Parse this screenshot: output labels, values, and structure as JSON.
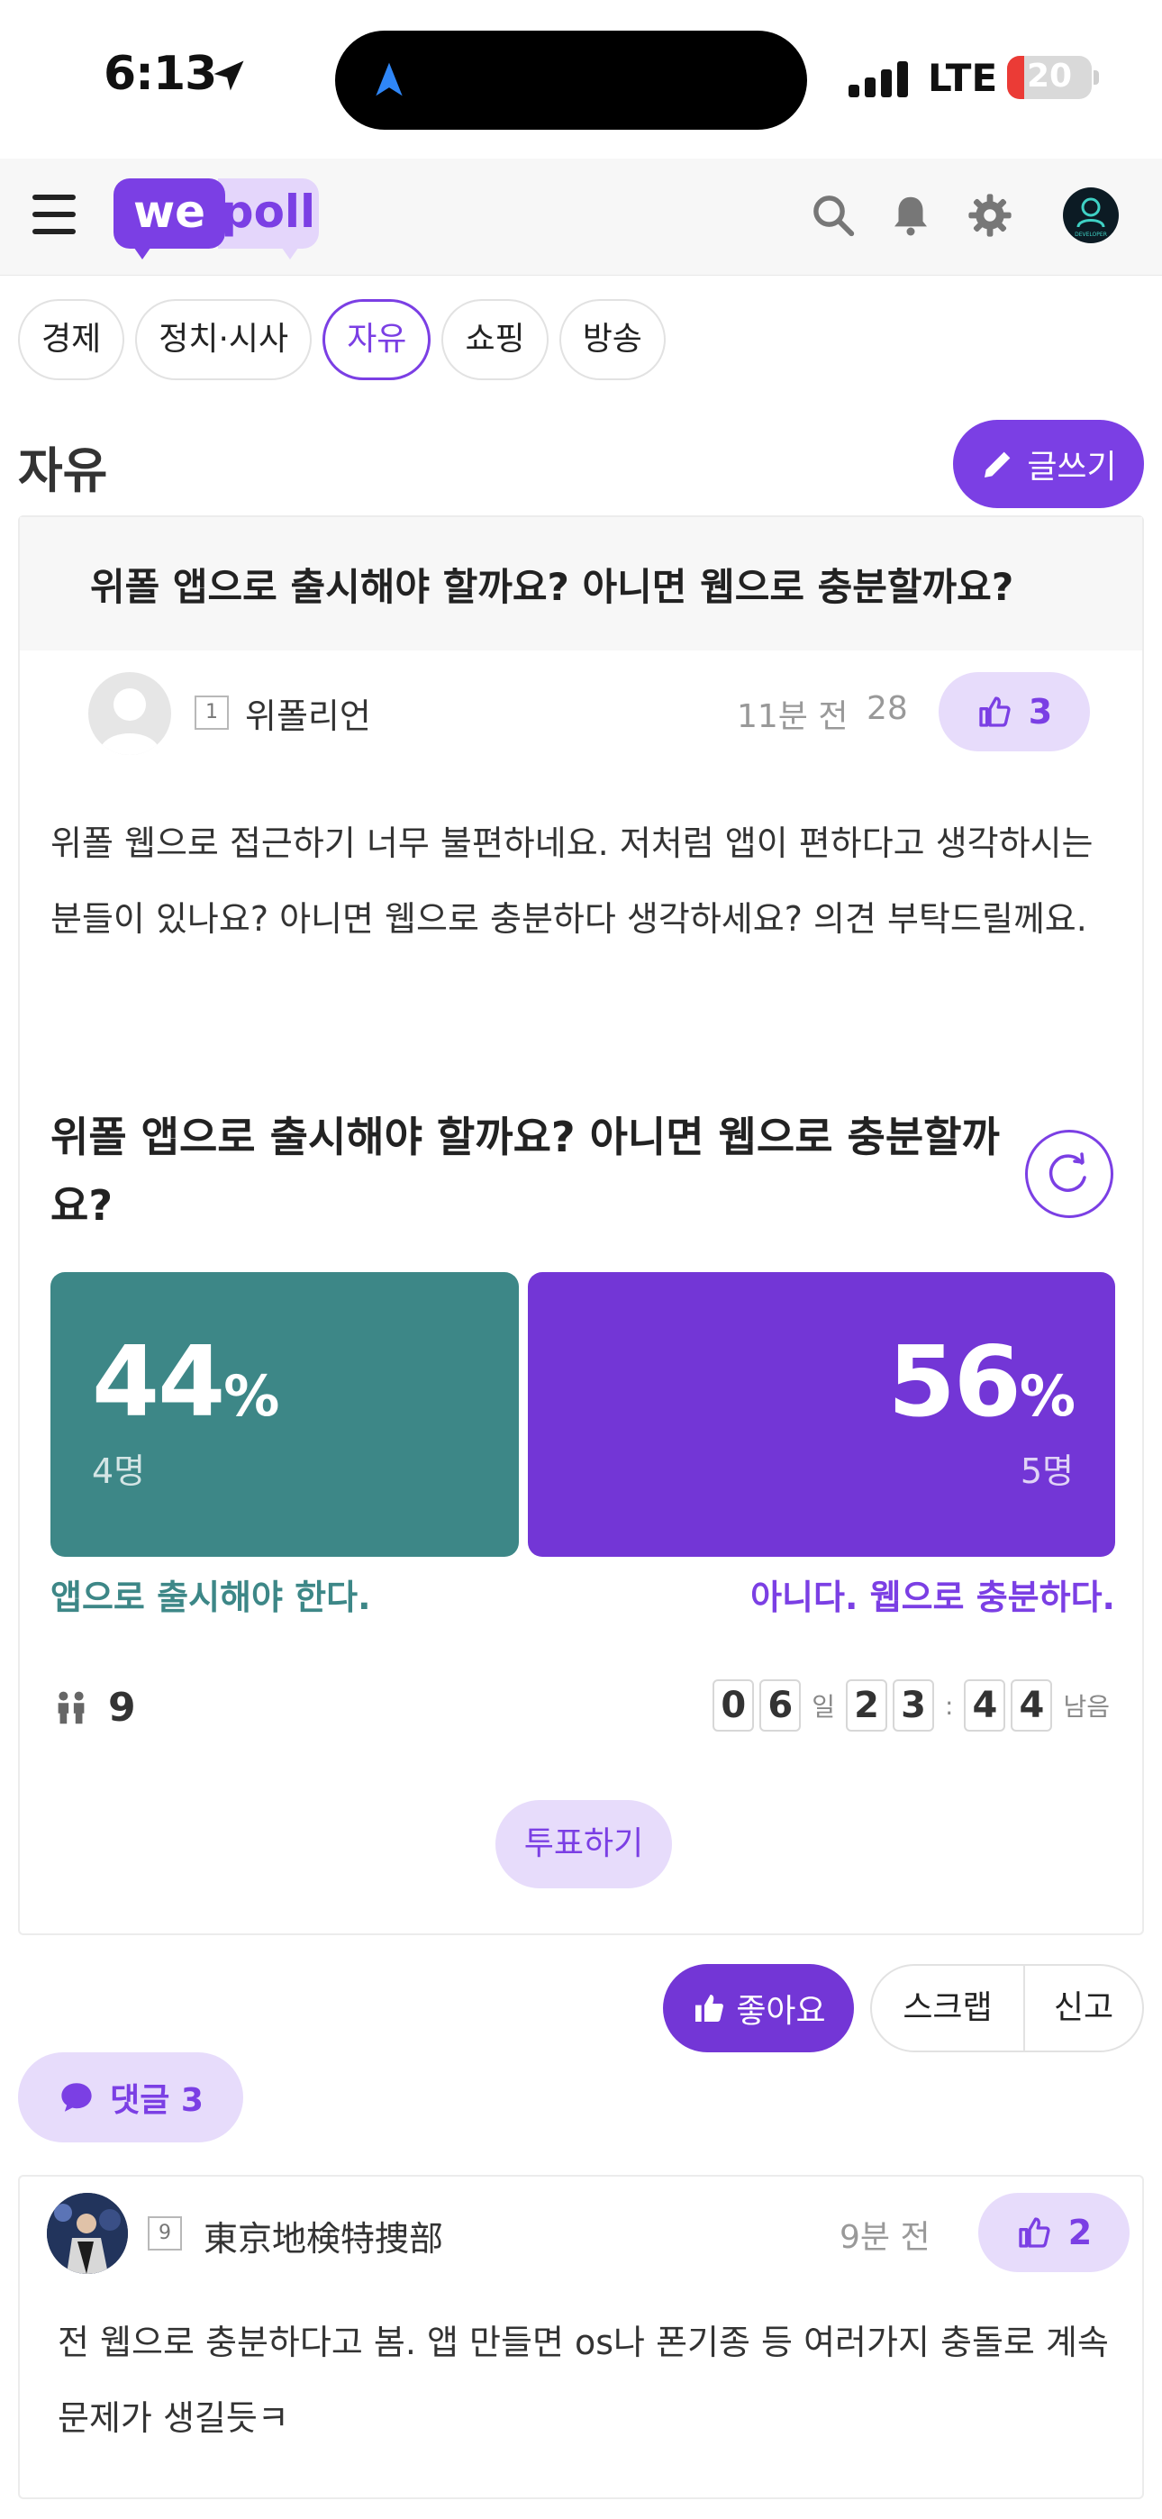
{
  "status": {
    "time": "6:13",
    "network": "LTE",
    "battery": "20",
    "battery_level": 0.2
  },
  "header": {
    "logo_we": "we",
    "logo_poll": "poll",
    "avatar_label": "DEVELOPER"
  },
  "categories": [
    {
      "label": "경제",
      "active": false
    },
    {
      "label": "정치·시사",
      "active": false
    },
    {
      "label": "자유",
      "active": true
    },
    {
      "label": "쇼핑",
      "active": false
    },
    {
      "label": "방송",
      "active": false
    }
  ],
  "board": {
    "title": "자유",
    "write_label": "글쓰기"
  },
  "post": {
    "title": "위폴 앱으로 출시해야 할까요? 아니면 웹으로 충분할까요?",
    "author_level": "1",
    "author": "위폴리언",
    "time": "11분 전",
    "views": "28",
    "likes": "3",
    "body": "위폴 웹으로 접근하기 너무 불편하네요. 저처럼 앱이 편하다고 생각하시는 분들이 있나요? 아니면 웹으로 충분하다 생각하세요? 의견 부탁드릴께요."
  },
  "poll": {
    "question": "위폴 앱으로 출시해야 할까요? 아니면 웹으로 충분할까요?",
    "options": [
      {
        "percent": "44",
        "unit": "%",
        "count": "4명",
        "label": "앱으로 출시해야 한다.",
        "color": "#3d8787"
      },
      {
        "percent": "56",
        "unit": "%",
        "count": "5명",
        "label": "아니다. 웹으로 충분하다.",
        "color": "#7336d6"
      }
    ],
    "voters": "9",
    "countdown": {
      "days": [
        "0",
        "6"
      ],
      "day_unit": "일",
      "hours": [
        "2",
        "3"
      ],
      "sep": ":",
      "minutes": [
        "4",
        "4"
      ],
      "remaining": "남음"
    },
    "vote_label": "투표하기"
  },
  "actions": {
    "like_label": "좋아요",
    "scrap_label": "스크랩",
    "report_label": "신고"
  },
  "comments_toggle": {
    "label": "댓글 3"
  },
  "comments": [
    {
      "level": "9",
      "author": "東京地検特捜部",
      "time": "9분 전",
      "likes": "2",
      "body": "전 웹으로 충분하다고 봄. 앱 만들면 os나 폰기종 등 여러가지 충돌로 계속 문제가 생길듯ㅋ"
    }
  ],
  "colors": {
    "accent": "#7b3fe4",
    "accent_light": "#e7dcfb",
    "teal": "#3d8787"
  }
}
